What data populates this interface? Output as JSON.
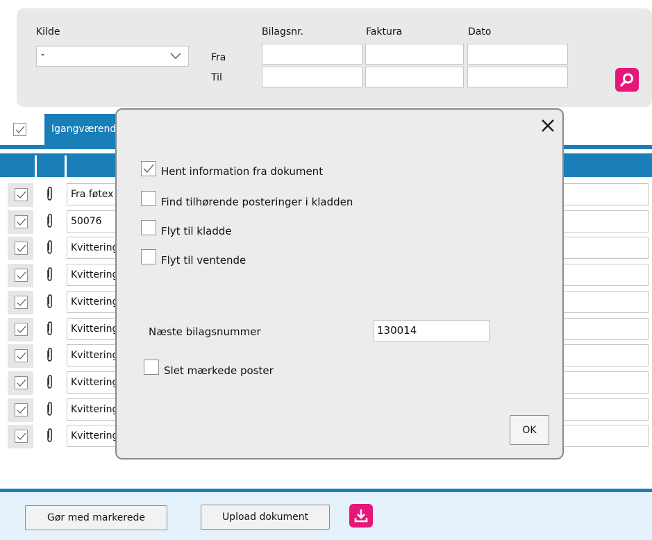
{
  "filter": {
    "kilde_label": "Kilde",
    "kilde_value": "-",
    "from_label": "Fra",
    "to_label": "Til",
    "col_bilagsnr": "Bilagsnr.",
    "col_faktura": "Faktura",
    "col_dato": "Dato",
    "search_icon": "search-icon"
  },
  "tabs": {
    "active_label": "Igangværende"
  },
  "rows": [
    {
      "text": "Fra føtex",
      "checked": true
    },
    {
      "text": "50076",
      "checked": true
    },
    {
      "text": "Kvittering",
      "checked": true
    },
    {
      "text": "Kvittering",
      "checked": true
    },
    {
      "text": "Kvittering",
      "checked": true
    },
    {
      "text": "Kvittering",
      "checked": true
    },
    {
      "text": "Kvittering",
      "checked": true
    },
    {
      "text": "Kvittering",
      "checked": true
    },
    {
      "text": "Kvittering",
      "checked": true
    },
    {
      "text": "Kvittering sendt fra Jørgen",
      "checked": true
    }
  ],
  "footer": {
    "mark_button": "Gør med markerede",
    "upload_button": "Upload dokument"
  },
  "dialog": {
    "opt_hent": "Hent information fra dokument",
    "opt_find": "Find tilhørende posteringer i kladden",
    "opt_flyt_kladde": "Flyt til kladde",
    "opt_flyt_ventende": "Flyt til ventende",
    "next_number_label": "Næste bilagsnummer",
    "next_number_value": "130014",
    "delete_label": "Slet mærkede poster",
    "ok_label": "OK",
    "close_glyph": "✕"
  },
  "colors": {
    "accent_blue": "#1a7fb8",
    "accent_pink": "#e6177a",
    "panel_grey": "#e9e9e9"
  }
}
